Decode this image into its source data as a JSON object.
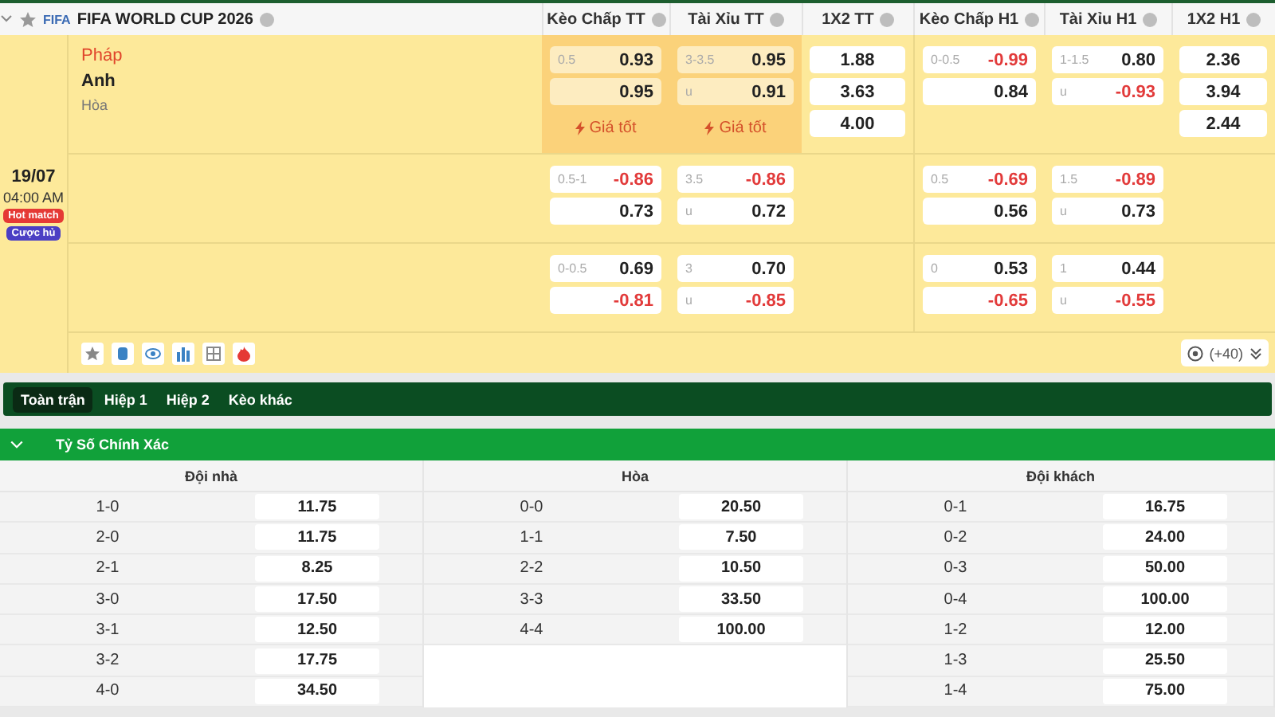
{
  "league": {
    "title": "FIFA WORLD CUP 2026",
    "logo": "FIFA",
    "starred": false
  },
  "columns": [
    "Kèo Chấp TT",
    "Tài Xỉu TT",
    "1X2 TT",
    "Kèo Chấp H1",
    "Tài Xỉu H1",
    "1X2 H1"
  ],
  "match": {
    "home": "Pháp",
    "away": "Anh",
    "draw": "Hòa",
    "date": "19/07",
    "time": "04:00 AM",
    "badges": [
      {
        "label": "Hot match",
        "color": "#e53935"
      },
      {
        "label": "Cược hủ",
        "color": "#4b3fc4"
      }
    ],
    "more_markets": "(+40)"
  },
  "lines": [
    {
      "cells": [
        {
          "kind": "pair",
          "highlighted": true,
          "best_price": "Giá tốt",
          "odds": [
            {
              "line": "0.5",
              "value": "0.93",
              "negative": false
            },
            {
              "value": "0.95",
              "negative": false
            }
          ]
        },
        {
          "kind": "pair",
          "highlighted": true,
          "best_price": "Giá tốt",
          "odds": [
            {
              "line": "3-3.5",
              "value": "0.95",
              "negative": false
            },
            {
              "line": "u",
              "value": "0.91",
              "negative": false
            }
          ]
        },
        {
          "kind": "triple",
          "values": [
            "1.88",
            "3.63",
            "4.00"
          ]
        },
        {
          "kind": "pair",
          "highlighted": false,
          "odds": [
            {
              "line": "0-0.5",
              "value": "-0.99",
              "negative": true
            },
            {
              "value": "0.84",
              "negative": false
            }
          ]
        },
        {
          "kind": "pair",
          "highlighted": false,
          "odds": [
            {
              "line": "1-1.5",
              "value": "0.80",
              "negative": false
            },
            {
              "line": "u",
              "value": "-0.93",
              "negative": true
            }
          ]
        },
        {
          "kind": "triple",
          "values": [
            "2.36",
            "3.94",
            "2.44"
          ]
        }
      ]
    },
    {
      "cells": [
        {
          "kind": "pair",
          "highlighted": false,
          "odds": [
            {
              "line": "0.5-1",
              "value": "-0.86",
              "negative": true
            },
            {
              "value": "0.73",
              "negative": false
            }
          ]
        },
        {
          "kind": "pair",
          "highlighted": false,
          "odds": [
            {
              "line": "3.5",
              "value": "-0.86",
              "negative": true
            },
            {
              "line": "u",
              "value": "0.72",
              "negative": false
            }
          ]
        },
        {
          "kind": "empty"
        },
        {
          "kind": "pair",
          "highlighted": false,
          "odds": [
            {
              "line": "0.5",
              "value": "-0.69",
              "negative": true
            },
            {
              "value": "0.56",
              "negative": false
            }
          ]
        },
        {
          "kind": "pair",
          "highlighted": false,
          "odds": [
            {
              "line": "1.5",
              "value": "-0.89",
              "negative": true
            },
            {
              "line": "u",
              "value": "0.73",
              "negative": false
            }
          ]
        },
        {
          "kind": "empty"
        }
      ]
    },
    {
      "cells": [
        {
          "kind": "pair",
          "highlighted": false,
          "odds": [
            {
              "line": "0-0.5",
              "value": "0.69",
              "negative": false
            },
            {
              "value": "-0.81",
              "negative": true
            }
          ]
        },
        {
          "kind": "pair",
          "highlighted": false,
          "odds": [
            {
              "line": "3",
              "value": "0.70",
              "negative": false
            },
            {
              "line": "u",
              "value": "-0.85",
              "negative": true
            }
          ]
        },
        {
          "kind": "empty"
        },
        {
          "kind": "pair",
          "highlighted": false,
          "odds": [
            {
              "line": "0",
              "value": "0.53",
              "negative": false
            },
            {
              "value": "-0.65",
              "negative": true
            }
          ]
        },
        {
          "kind": "pair",
          "highlighted": false,
          "odds": [
            {
              "line": "1",
              "value": "0.44",
              "negative": false
            },
            {
              "line": "u",
              "value": "-0.55",
              "negative": true
            }
          ]
        },
        {
          "kind": "empty"
        }
      ]
    }
  ],
  "tabs": [
    {
      "label": "Toàn trận",
      "selected": true
    },
    {
      "label": "Hiệp 1",
      "selected": false
    },
    {
      "label": "Hiệp 2",
      "selected": false
    },
    {
      "label": "Kèo khác",
      "selected": false
    }
  ],
  "section": {
    "title": "Tỷ Số Chính Xác",
    "expanded": true
  },
  "score_table": [
    {
      "header": "Đội nhà",
      "rows": [
        {
          "score": "1-0",
          "odd": "11.75"
        },
        {
          "score": "2-0",
          "odd": "11.75"
        },
        {
          "score": "2-1",
          "odd": "8.25"
        },
        {
          "score": "3-0",
          "odd": "17.50"
        },
        {
          "score": "3-1",
          "odd": "12.50"
        },
        {
          "score": "3-2",
          "odd": "17.75"
        },
        {
          "score": "4-0",
          "odd": "34.50"
        }
      ]
    },
    {
      "header": "Hòa",
      "rows": [
        {
          "score": "0-0",
          "odd": "20.50"
        },
        {
          "score": "1-1",
          "odd": "7.50"
        },
        {
          "score": "2-2",
          "odd": "10.50"
        },
        {
          "score": "3-3",
          "odd": "33.50"
        },
        {
          "score": "4-4",
          "odd": "100.00"
        }
      ]
    },
    {
      "header": "Đội khách",
      "rows": [
        {
          "score": "0-1",
          "odd": "16.75"
        },
        {
          "score": "0-2",
          "odd": "24.00"
        },
        {
          "score": "0-3",
          "odd": "50.00"
        },
        {
          "score": "0-4",
          "odd": "100.00"
        },
        {
          "score": "1-2",
          "odd": "12.00"
        },
        {
          "score": "1-3",
          "odd": "25.50"
        },
        {
          "score": "1-4",
          "odd": "75.00"
        }
      ]
    }
  ]
}
